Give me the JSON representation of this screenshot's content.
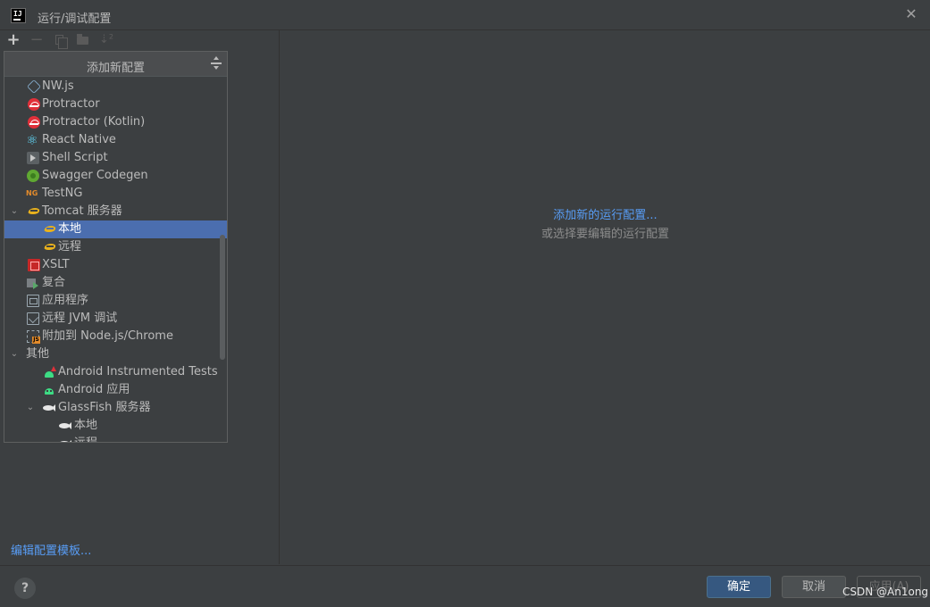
{
  "window": {
    "title": "运行/调试配置",
    "app_icon_text": "IJ"
  },
  "toolbar": {
    "add": "+",
    "remove": "−",
    "sort": "⇣²"
  },
  "popup": {
    "title": "添加新配置",
    "items": [
      {
        "label": "NW.js",
        "icon": "nwjs-icon",
        "indent": 0
      },
      {
        "label": "Protractor",
        "icon": "protractor-icon",
        "indent": 0
      },
      {
        "label": "Protractor (Kotlin)",
        "icon": "protractor-icon",
        "indent": 0
      },
      {
        "label": "React Native",
        "icon": "react-icon",
        "indent": 0
      },
      {
        "label": "Shell Script",
        "icon": "shell-script-icon",
        "indent": 0
      },
      {
        "label": "Swagger Codegen",
        "icon": "swagger-icon",
        "indent": 0
      },
      {
        "label": "TestNG",
        "icon": "testng-icon",
        "indent": 0
      },
      {
        "label": "Tomcat 服务器",
        "icon": "tomcat-icon",
        "indent": 0,
        "expanded": true
      },
      {
        "label": "本地",
        "icon": "tomcat-icon",
        "indent": 1,
        "selected": true
      },
      {
        "label": "远程",
        "icon": "tomcat-icon",
        "indent": 1
      },
      {
        "label": "XSLT",
        "icon": "xslt-icon",
        "indent": 0
      },
      {
        "label": "复合",
        "icon": "compound-icon",
        "indent": 0
      },
      {
        "label": "应用程序",
        "icon": "application-icon",
        "indent": 0
      },
      {
        "label": "远程 JVM 调试",
        "icon": "remote-jvm-icon",
        "indent": 0
      },
      {
        "label": "附加到 Node.js/Chrome",
        "icon": "attach-nodejs-icon",
        "indent": 0
      },
      {
        "label": "其他",
        "icon": "",
        "indent": -1,
        "expanded": true
      },
      {
        "label": "Android Instrumented Tests",
        "icon": "android-test-icon",
        "indent": 1
      },
      {
        "label": "Android 应用",
        "icon": "android-icon",
        "indent": 1
      },
      {
        "label": "GlassFish 服务器",
        "icon": "glassfish-icon",
        "indent": 1,
        "expanded": true
      },
      {
        "label": "本地",
        "icon": "glassfish-icon",
        "indent": 2
      },
      {
        "label": "远程",
        "icon": "glassfish-icon",
        "indent": 2
      }
    ]
  },
  "left": {
    "edit_templates": "编辑配置模板..."
  },
  "right": {
    "add_link": "添加新的运行配置...",
    "or_text": "或选择要编辑的运行配置"
  },
  "buttons": {
    "help": "?",
    "ok": "确定",
    "cancel": "取消",
    "apply": "应用(A)"
  },
  "watermark": "CSDN @An1ong",
  "colors": {
    "background": "#3c3f41",
    "selection": "#4b6eaf",
    "link": "#589df6",
    "ok_button": "#365880"
  }
}
